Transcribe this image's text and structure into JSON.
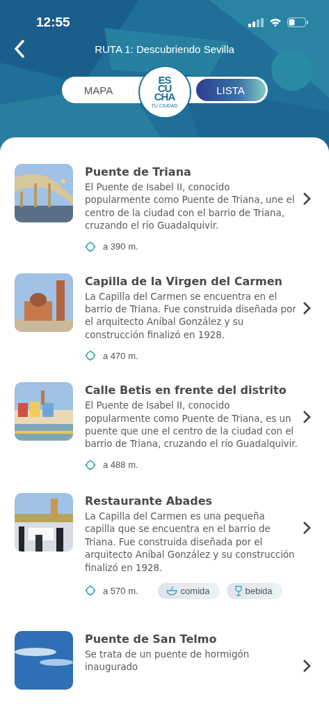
{
  "status_bar": {
    "time": "12:55"
  },
  "header": {
    "title": "RUTA 1: Descubriendo Sevilla"
  },
  "view_toggle": [
    {
      "label": "MAPA",
      "selected": false
    },
    {
      "label": "LISTA",
      "selected": true
    }
  ],
  "logo": {
    "lines": [
      "ES",
      "CU",
      "CHA"
    ],
    "tagline": "TU CIUDAD"
  },
  "places": [
    {
      "image": {
        "kind": "picture"
      },
      "title": "Puente de Triana",
      "description": "El Puente de Isabel II, conocido popularmente como Puente de Triana, une el centro de la ciudad con el barrio de Triana, cruzando el río Guadalquivir.",
      "distance": "a 390 m."
    },
    {
      "image": {
        "kind": "picture"
      },
      "title": "Capilla de la Virgen del Carmen",
      "description": "La Capilla del Carmen se encuentra en el barrio de Triana. Fue construida diseñada por el arquitecto Aníbal González y su construcción finalizó en 1928.",
      "distance": "a 470 m."
    },
    {
      "image": {
        "kind": "picture"
      },
      "title": "Calle Betis en frente del distrito",
      "description": "El Puente de Isabel II, conocido popularmente como Puente de Triana, es un puente que une el centro de la ciudad con el barrio de Triana, cruzando el río Guadalquivir.",
      "distance": "a 488 m."
    },
    {
      "image": {
        "kind": "picture"
      },
      "title": "Restaurante Abades",
      "description": "La Capilla del Carmen es una pequeña capilla que se encuentra en el barrio de Triana. Fue construida diseñada por el arquitecto Aníbal González y su construcción finalizó en 1928.",
      "distance": "a 570 m.",
      "tags": [
        {
          "kind": "food",
          "label": "comida"
        },
        {
          "kind": "drink",
          "label": "bebida"
        }
      ]
    },
    {
      "image": {
        "kind": "picture"
      },
      "title": "Puente de San Telmo",
      "description": "Se trata de un puente de hormigón inaugurado"
    }
  ]
}
